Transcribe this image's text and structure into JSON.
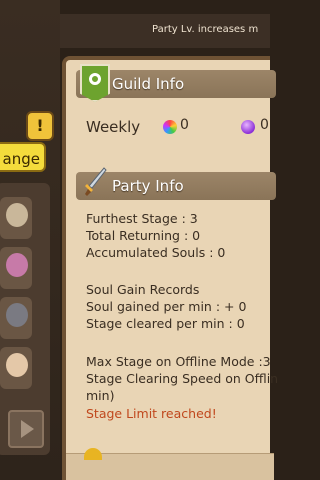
{
  "banner": {
    "text": "Party Lv. increases m"
  },
  "quest_badge": "!",
  "change_button": "ange",
  "guild_info": {
    "title": "Guild Info",
    "weekly_label": "Weekly",
    "rainbow_gem_count": "0",
    "purple_gem_count": "0"
  },
  "party_info": {
    "title": "Party Info",
    "furthest_stage": "Furthest Stage : 3",
    "total_returning": "Total Returning : 0",
    "accumulated_souls": "Accumulated Souls : 0",
    "soul_records_heading": "Soul Gain Records",
    "soul_per_min": "Soul gained per min : + 0",
    "stage_per_min": "Stage cleared per min : 0",
    "max_offline_stage": "Max Stage on Offline Mode :3",
    "clearing_speed_line1": "Stage Clearing Speed on Offlin",
    "clearing_speed_line2": "min)",
    "limit_warning": "Stage Limit reached!"
  },
  "colors": {
    "panel": "#e9d5b5",
    "header": "#9c8568",
    "warning": "#c0481d",
    "change_button": "#f4dc3c"
  },
  "icons": [
    "exclamation-icon",
    "guild-emblem-icon",
    "sword-icon",
    "rainbow-gem-icon",
    "purple-gem-icon",
    "play-icon"
  ]
}
